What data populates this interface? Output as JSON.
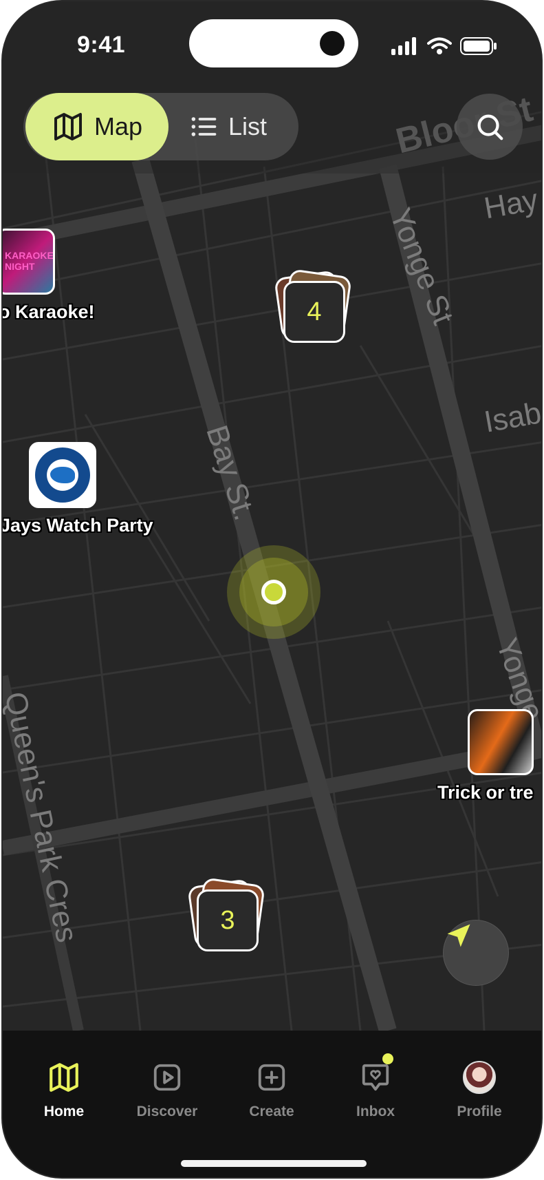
{
  "status_bar": {
    "time": "9:41"
  },
  "view_toggle": {
    "map_label": "Map",
    "list_label": "List",
    "selected": "Map"
  },
  "map": {
    "streets": [
      "Yonge St",
      "Bay St.",
      "Queen's Park Cres",
      "Yonge",
      "Hay",
      "Isab",
      "Bloor St"
    ],
    "events": [
      {
        "label": "o Karaoke!"
      },
      {
        "label": "Jays Watch Party"
      },
      {
        "label": "Trick or tre"
      }
    ],
    "clusters": [
      {
        "count": "4"
      },
      {
        "count": "3"
      }
    ]
  },
  "bottom_nav": {
    "items": [
      {
        "label": "Home",
        "icon": "map-icon",
        "active": true
      },
      {
        "label": "Discover",
        "icon": "play-icon"
      },
      {
        "label": "Create",
        "icon": "plus-square-icon"
      },
      {
        "label": "Inbox",
        "icon": "heart-message-icon",
        "badge": true
      },
      {
        "label": "Profile",
        "icon": "avatar"
      }
    ]
  },
  "colors": {
    "accent": "#dcee8c",
    "cluster_text": "#e9f35a",
    "background": "#262626"
  }
}
